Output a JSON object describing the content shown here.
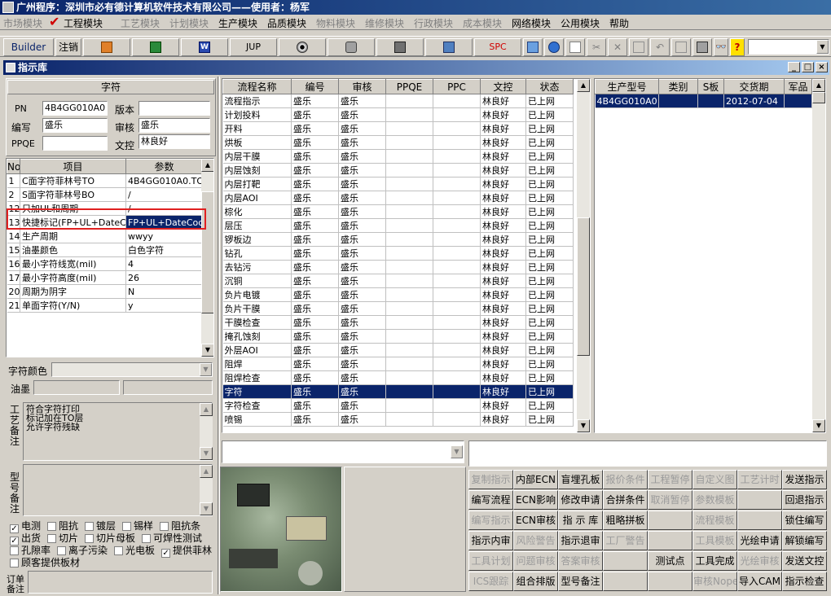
{
  "app": {
    "title": "广州程序：深圳市必有德计算机软件技术有限公司——使用者：杨军"
  },
  "menu": [
    {
      "label": "市场模块",
      "enabled": false
    },
    {
      "label": "工程模块",
      "enabled": true,
      "checked": true
    },
    {
      "label": "工艺模块",
      "enabled": false
    },
    {
      "label": "计划模块",
      "enabled": false
    },
    {
      "label": "生产模块",
      "enabled": true
    },
    {
      "label": "品质模块",
      "enabled": true
    },
    {
      "label": "物料模块",
      "enabled": false
    },
    {
      "label": "维修模块",
      "enabled": false
    },
    {
      "label": "行政模块",
      "enabled": false
    },
    {
      "label": "成本模块",
      "enabled": false
    },
    {
      "label": "网络模块",
      "enabled": true
    },
    {
      "label": "公用模块",
      "enabled": true
    },
    {
      "label": "帮助",
      "enabled": true
    }
  ],
  "toolbar": {
    "builder": "Builder",
    "logout": "注销",
    "jup": "JUP",
    "spc": "SPC"
  },
  "window": {
    "title": "指示库",
    "min": "_",
    "max": "□",
    "close": "×"
  },
  "left": {
    "section_title": "字符",
    "pn_label": "PN",
    "pn_value": "4B4GG010A0",
    "version_label": "版本",
    "version_value": "",
    "author_label": "编写",
    "author_value": "盛乐",
    "review_label": "审核",
    "review_value": "盛乐",
    "ppqe_label": "PPQE",
    "ppqe_value": "",
    "doc_label": "文控",
    "doc_value": "林良好",
    "param_headers": [
      "No",
      "项目",
      "参数"
    ],
    "params": [
      {
        "no": "1",
        "item": "C面字符菲林号TO",
        "value": "4B4GG010A0.TO"
      },
      {
        "no": "2",
        "item": "S面字符菲林号BO",
        "value": "/"
      },
      {
        "no": "12",
        "item": "只加UL和周期",
        "value": "/"
      },
      {
        "no": "13",
        "item": "快捷标记(FP+UL+DateCode)",
        "value": "FP+UL+DateCode"
      },
      {
        "no": "14",
        "item": "生产周期",
        "value": "wwyy"
      },
      {
        "no": "15",
        "item": "油墨颜色",
        "value": "白色字符"
      },
      {
        "no": "16",
        "item": "最小字符线宽(mil)",
        "value": "4"
      },
      {
        "no": "17",
        "item": "最小字符高度(mil)",
        "value": "26"
      },
      {
        "no": "20",
        "item": "周期为阴字",
        "value": "N"
      },
      {
        "no": "21",
        "item": "单面字符(Y/N)",
        "value": "y"
      }
    ],
    "char_color_label": "字符颜色",
    "ink_label": "油墨",
    "process_note_label": "工艺备注",
    "process_note_lines": [
      "符合字符打印",
      "标记加在TO层",
      "允许字符残缺"
    ],
    "model_note_label": "型号备注",
    "order_note_label": "订单备注",
    "checks": [
      [
        {
          "label": "电测",
          "checked": true
        },
        {
          "label": "阻抗",
          "checked": false
        },
        {
          "label": "镀层",
          "checked": false
        },
        {
          "label": "锡样",
          "checked": false
        },
        {
          "label": "阻抗条",
          "checked": false
        }
      ],
      [
        {
          "label": "出货",
          "checked": true
        },
        {
          "label": "切片",
          "checked": false
        },
        {
          "label": "切片母板",
          "checked": false
        },
        {
          "label": "可焊性测试",
          "checked": false
        }
      ],
      [
        {
          "label": "孔隙率",
          "checked": false
        },
        {
          "label": "离子污染",
          "checked": false
        },
        {
          "label": "光电板",
          "checked": false
        },
        {
          "label": "提供菲林",
          "checked": true
        }
      ],
      [
        {
          "label": "顾客提供板材",
          "checked": false
        }
      ]
    ]
  },
  "flow": {
    "headers": [
      "流程名称",
      "编号",
      "审核",
      "PPQE",
      "PPC",
      "文控",
      "状态"
    ],
    "rows": [
      [
        "流程指示",
        "盛乐",
        "盛乐",
        "",
        "",
        "林良好",
        "已上网"
      ],
      [
        "计划投料",
        "盛乐",
        "盛乐",
        "",
        "",
        "林良好",
        "已上网"
      ],
      [
        "开料",
        "盛乐",
        "盛乐",
        "",
        "",
        "林良好",
        "已上网"
      ],
      [
        "烘板",
        "盛乐",
        "盛乐",
        "",
        "",
        "林良好",
        "已上网"
      ],
      [
        "内层干膜",
        "盛乐",
        "盛乐",
        "",
        "",
        "林良好",
        "已上网"
      ],
      [
        "内层蚀刻",
        "盛乐",
        "盛乐",
        "",
        "",
        "林良好",
        "已上网"
      ],
      [
        "内层打靶",
        "盛乐",
        "盛乐",
        "",
        "",
        "林良好",
        "已上网"
      ],
      [
        "内层AOI",
        "盛乐",
        "盛乐",
        "",
        "",
        "林良好",
        "已上网"
      ],
      [
        "棕化",
        "盛乐",
        "盛乐",
        "",
        "",
        "林良好",
        "已上网"
      ],
      [
        "层压",
        "盛乐",
        "盛乐",
        "",
        "",
        "林良好",
        "已上网"
      ],
      [
        "锣板边",
        "盛乐",
        "盛乐",
        "",
        "",
        "林良好",
        "已上网"
      ],
      [
        "钻孔",
        "盛乐",
        "盛乐",
        "",
        "",
        "林良好",
        "已上网"
      ],
      [
        "去钻污",
        "盛乐",
        "盛乐",
        "",
        "",
        "林良好",
        "已上网"
      ],
      [
        "沉铜",
        "盛乐",
        "盛乐",
        "",
        "",
        "林良好",
        "已上网"
      ],
      [
        "负片电镀",
        "盛乐",
        "盛乐",
        "",
        "",
        "林良好",
        "已上网"
      ],
      [
        "负片干膜",
        "盛乐",
        "盛乐",
        "",
        "",
        "林良好",
        "已上网"
      ],
      [
        "干膜检查",
        "盛乐",
        "盛乐",
        "",
        "",
        "林良好",
        "已上网"
      ],
      [
        "掩孔蚀刻",
        "盛乐",
        "盛乐",
        "",
        "",
        "林良好",
        "已上网"
      ],
      [
        "外层AOI",
        "盛乐",
        "盛乐",
        "",
        "",
        "林良好",
        "已上网"
      ],
      [
        "阻焊",
        "盛乐",
        "盛乐",
        "",
        "",
        "林良好",
        "已上网"
      ],
      [
        "阻焊检查",
        "盛乐",
        "盛乐",
        "",
        "",
        "林良好",
        "已上网"
      ],
      [
        "字符",
        "盛乐",
        "盛乐",
        "",
        "",
        "林良好",
        "已上网"
      ],
      [
        "字符检查",
        "盛乐",
        "盛乐",
        "",
        "",
        "林良好",
        "已上网"
      ],
      [
        "喷锡",
        "盛乐",
        "盛乐",
        "",
        "",
        "林良好",
        "已上网"
      ]
    ],
    "selected_index": 21
  },
  "production": {
    "headers": [
      "生产型号",
      "类别",
      "S板",
      "交货期",
      "军品"
    ],
    "rows": [
      [
        "4B4GG010A0",
        "",
        "",
        "2012-07-04",
        ""
      ]
    ]
  },
  "buttons": [
    [
      {
        "label": "复制指示",
        "enabled": false
      },
      {
        "label": "内部ECN",
        "enabled": true
      },
      {
        "label": "盲埋孔板",
        "enabled": true
      },
      {
        "label": "报价条件",
        "enabled": false
      },
      {
        "label": "工程暂停",
        "enabled": false
      },
      {
        "label": "自定义图",
        "enabled": false
      },
      {
        "label": "工艺计时",
        "enabled": false
      },
      {
        "label": "发送指示",
        "enabled": true
      }
    ],
    [
      {
        "label": "编写流程",
        "enabled": true
      },
      {
        "label": "ECN影响",
        "enabled": true
      },
      {
        "label": "修改申请",
        "enabled": true
      },
      {
        "label": "合拼条件",
        "enabled": true
      },
      {
        "label": "取消暂停",
        "enabled": false
      },
      {
        "label": "参数模板",
        "enabled": false
      },
      {
        "label": "",
        "enabled": false
      },
      {
        "label": "回退指示",
        "enabled": true
      }
    ],
    [
      {
        "label": "编写指示",
        "enabled": false
      },
      {
        "label": "ECN审核",
        "enabled": true
      },
      {
        "label": "指 示 库",
        "enabled": true
      },
      {
        "label": "粗略拼板",
        "enabled": true
      },
      {
        "label": "",
        "enabled": false
      },
      {
        "label": "流程模板",
        "enabled": false
      },
      {
        "label": "",
        "enabled": false
      },
      {
        "label": "锁住编写",
        "enabled": true
      }
    ],
    [
      {
        "label": "指示内审",
        "enabled": true
      },
      {
        "label": "风险警告",
        "enabled": false
      },
      {
        "label": "指示退审",
        "enabled": true
      },
      {
        "label": "工厂警告",
        "enabled": false
      },
      {
        "label": "",
        "enabled": false
      },
      {
        "label": "工具模板",
        "enabled": false
      },
      {
        "label": "光绘申请",
        "enabled": true
      },
      {
        "label": "解锁编写",
        "enabled": true
      }
    ],
    [
      {
        "label": "工具计划",
        "enabled": false
      },
      {
        "label": "问题审核",
        "enabled": false
      },
      {
        "label": "答案审核",
        "enabled": false
      },
      {
        "label": "",
        "enabled": false
      },
      {
        "label": "测试点",
        "enabled": true
      },
      {
        "label": "工具完成",
        "enabled": true
      },
      {
        "label": "光绘审核",
        "enabled": false
      },
      {
        "label": "发送文控",
        "enabled": true
      }
    ],
    [
      {
        "label": "ICS跟踪",
        "enabled": false
      },
      {
        "label": "组合排版",
        "enabled": true
      },
      {
        "label": "型号备注",
        "enabled": true
      },
      {
        "label": "",
        "enabled": false
      },
      {
        "label": "",
        "enabled": false
      },
      {
        "label": "审核Nope",
        "enabled": false
      },
      {
        "label": "导入CAM",
        "enabled": true
      },
      {
        "label": "指示检查",
        "enabled": true
      }
    ]
  ]
}
